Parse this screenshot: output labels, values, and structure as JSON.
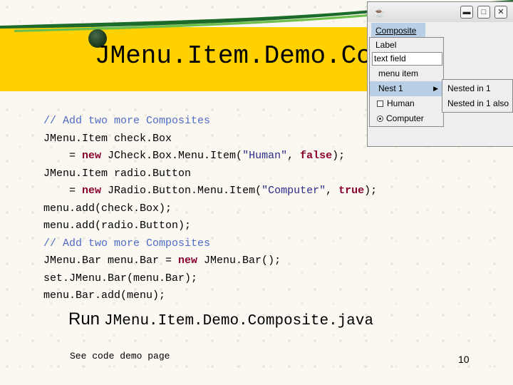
{
  "slide": {
    "title": "JMenu.Item.Demo.Com",
    "code_lines": [
      {
        "parts": [
          {
            "t": "// Add two more Composites",
            "c": "comment"
          }
        ]
      },
      {
        "parts": [
          {
            "t": "JMenu.Item check.Box",
            "c": ""
          }
        ]
      },
      {
        "parts": [
          {
            "t": "    = ",
            "c": ""
          },
          {
            "t": "new",
            "c": "kw"
          },
          {
            "t": " JCheck.Box.Menu.Item(",
            "c": ""
          },
          {
            "t": "\"Human\"",
            "c": "str"
          },
          {
            "t": ", ",
            "c": ""
          },
          {
            "t": "false",
            "c": "kw"
          },
          {
            "t": ");",
            "c": ""
          }
        ]
      },
      {
        "parts": [
          {
            "t": "JMenu.Item radio.Button",
            "c": ""
          }
        ]
      },
      {
        "parts": [
          {
            "t": "    = ",
            "c": ""
          },
          {
            "t": "new",
            "c": "kw"
          },
          {
            "t": " JRadio.Button.Menu.Item(",
            "c": ""
          },
          {
            "t": "\"Computer\"",
            "c": "str"
          },
          {
            "t": ", ",
            "c": ""
          },
          {
            "t": "true",
            "c": "kw"
          },
          {
            "t": ");",
            "c": ""
          }
        ]
      },
      {
        "parts": [
          {
            "t": "menu.add(check.Box);",
            "c": ""
          }
        ]
      },
      {
        "parts": [
          {
            "t": "menu.add(radio.Button);",
            "c": ""
          }
        ]
      },
      {
        "parts": [
          {
            "t": "// Add two more Composites",
            "c": "comment"
          }
        ]
      },
      {
        "parts": [
          {
            "t": "JMenu.Bar menu.Bar = ",
            "c": ""
          },
          {
            "t": "new",
            "c": "kw"
          },
          {
            "t": " JMenu.Bar();",
            "c": ""
          }
        ]
      },
      {
        "parts": [
          {
            "t": "set.JMenu.Bar(menu.Bar);",
            "c": ""
          }
        ]
      },
      {
        "parts": [
          {
            "t": "menu.Bar.add(menu);",
            "c": ""
          }
        ]
      }
    ],
    "run_word": "Run",
    "run_file": "JMenu.Item.Demo.Composite.java",
    "see_code": "See code demo page",
    "page_number": "10"
  },
  "window": {
    "app_icon": "java-cup-icon",
    "buttons": {
      "minimize": "▬",
      "maximize": "□",
      "close": "✕"
    },
    "menu_title": "Composite",
    "menu": {
      "label": "Label",
      "text_field": "text field",
      "menu_item": "menu item",
      "nest": "Nest 1",
      "check": "Human",
      "radio": "Computer"
    },
    "submenu": [
      "Nested in 1",
      "Nested in 1 also"
    ]
  },
  "colors": {
    "band": "#ffd100",
    "menu_highlight": "#b8cfe5",
    "comment": "#4f6bc8",
    "keyword": "#8b0030"
  }
}
